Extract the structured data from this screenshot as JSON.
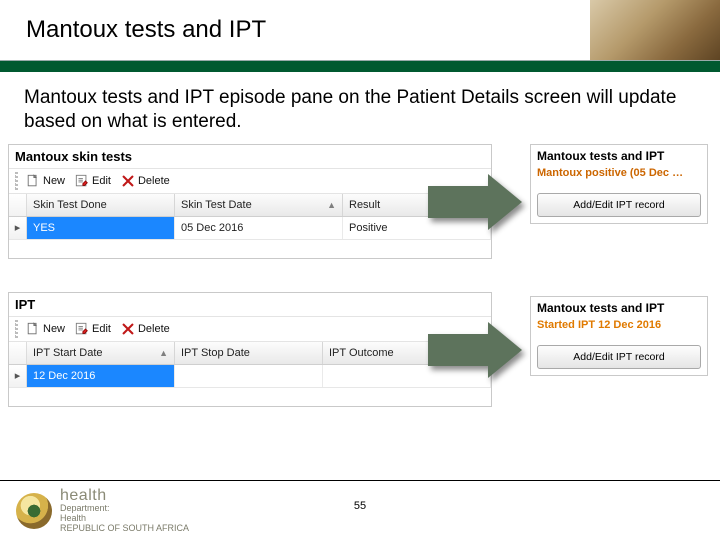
{
  "header": {
    "title": "Mantoux tests and IPT"
  },
  "intro": "Mantoux tests and IPT episode pane on the Patient Details screen will update based on what is entered.",
  "mantoux_panel": {
    "title": "Mantoux skin tests",
    "toolbar": {
      "new": "New",
      "edit": "Edit",
      "delete": "Delete"
    },
    "columns": {
      "c1": "Skin Test Done",
      "c2": "Skin Test Date",
      "c3": "Result"
    },
    "row": {
      "done": "YES",
      "date": "05 Dec 2016",
      "result": "Positive"
    }
  },
  "ipt_panel": {
    "title": "IPT",
    "toolbar": {
      "new": "New",
      "edit": "Edit",
      "delete": "Delete"
    },
    "columns": {
      "c1": "IPT Start Date",
      "c2": "IPT Stop Date",
      "c3": "IPT Outcome"
    },
    "row": {
      "start": "12 Dec 2016",
      "stop": "",
      "outcome": ""
    }
  },
  "right_top": {
    "title": "Mantoux tests and IPT",
    "status": "Mantoux positive (05 Dec …",
    "button": "Add/Edit IPT record"
  },
  "right_bottom": {
    "title": "Mantoux tests and IPT",
    "status": "Started IPT 12 Dec 2016",
    "button": "Add/Edit IPT record"
  },
  "footer": {
    "brand": "health",
    "line1": "Department:",
    "line2": "Health",
    "line3": "REPUBLIC OF SOUTH AFRICA",
    "page": "55"
  }
}
